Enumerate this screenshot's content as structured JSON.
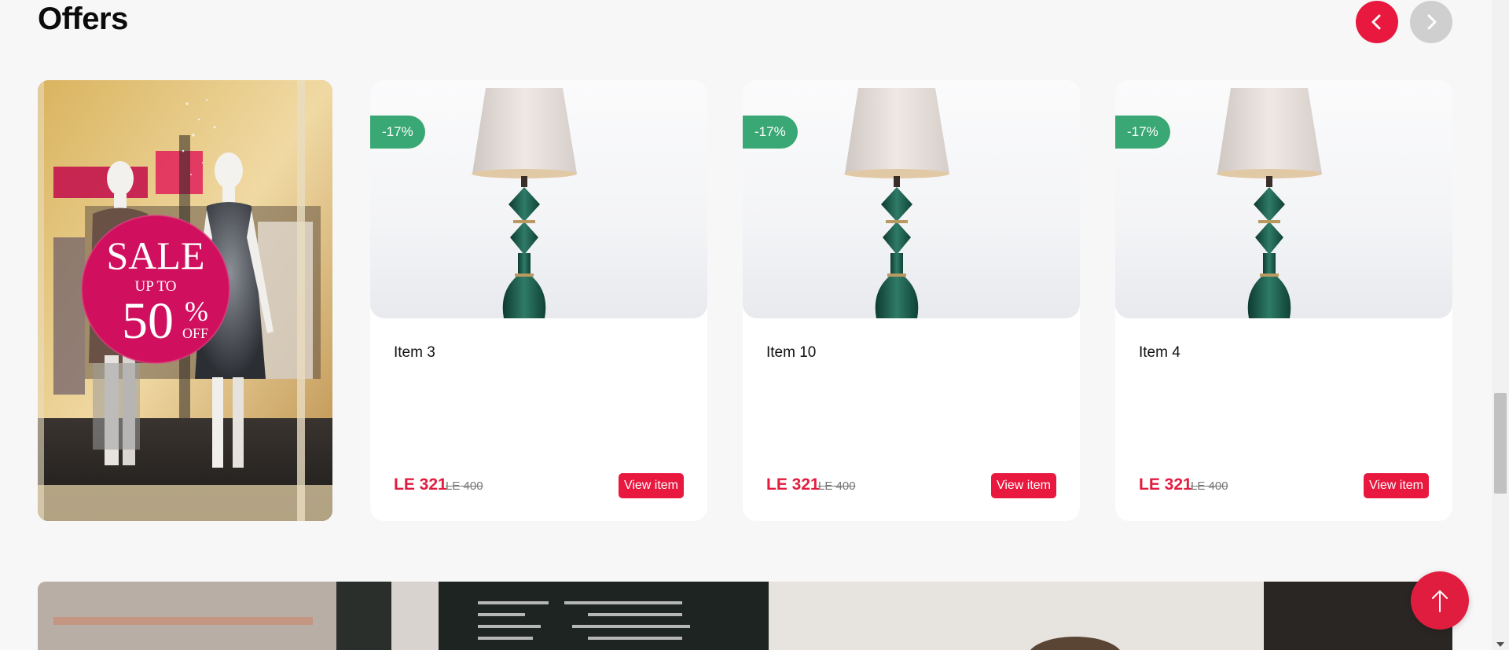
{
  "section": {
    "title": "Offers"
  },
  "carousel": {
    "prev_icon": "chevron-left-icon",
    "next_icon": "chevron-right-icon"
  },
  "promo": {
    "sale_text": "SALE",
    "up_to_text": "UP TO",
    "percent_text": "50",
    "percent_sign": "%",
    "off_text": "OFF"
  },
  "products": [
    {
      "badge": "-17%",
      "name": "Item 3",
      "price": "LE 321",
      "old_price": "LE 400",
      "button": "View item"
    },
    {
      "badge": "-17%",
      "name": "Item 10",
      "price": "LE 321",
      "old_price": "LE 400",
      "button": "View item"
    },
    {
      "badge": "-17%",
      "name": "Item 4",
      "price": "LE 321",
      "old_price": "LE 400",
      "button": "View item"
    }
  ],
  "scroll_top": {
    "icon": "arrow-up-icon"
  },
  "colors": {
    "accent": "#e8183f",
    "badge": "#3aa874",
    "disabled": "#cfcfcf",
    "background": "#f7f7f7"
  }
}
